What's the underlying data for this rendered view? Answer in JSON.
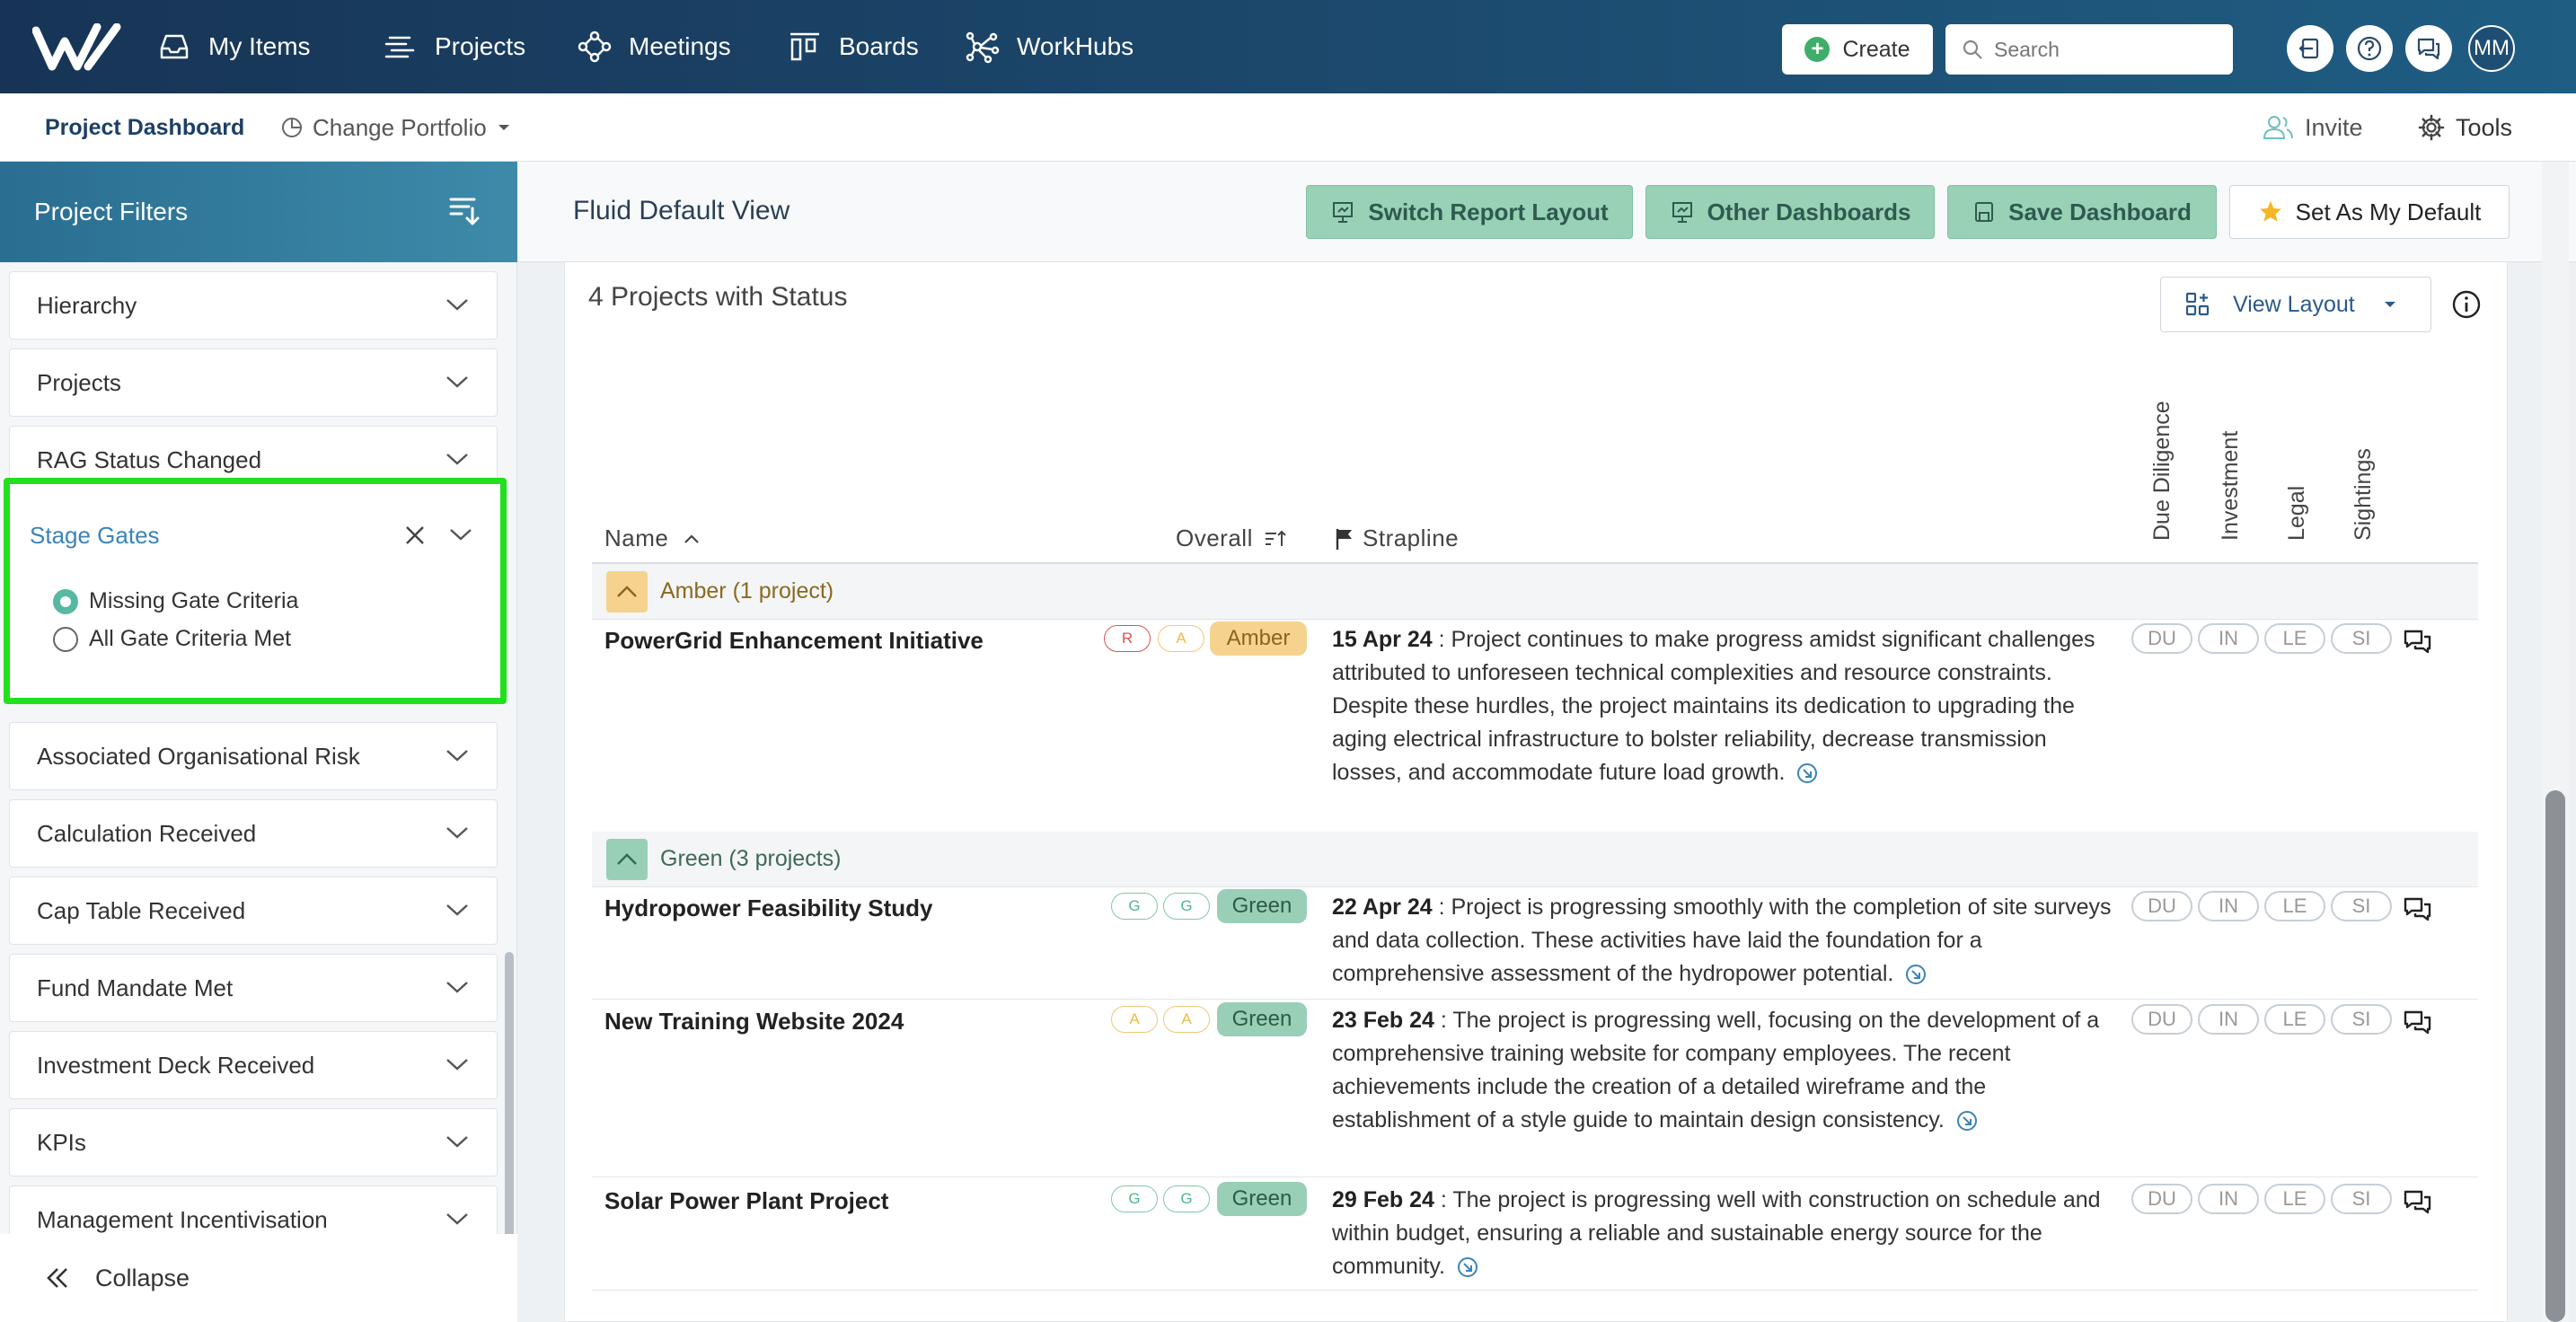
{
  "nav": {
    "items": [
      {
        "label": "My Items",
        "icon": "inbox-icon"
      },
      {
        "label": "Projects",
        "icon": "projects-icon"
      },
      {
        "label": "Meetings",
        "icon": "meetings-icon"
      },
      {
        "label": "Boards",
        "icon": "boards-icon"
      },
      {
        "label": "WorkHubs",
        "icon": "workhubs-icon"
      }
    ],
    "create_label": "Create",
    "search_placeholder": "Search",
    "avatar_initials": "MM"
  },
  "subnav": {
    "dashboard_label": "Project Dashboard",
    "portfolio_label": "Change Portfolio",
    "invite_label": "Invite",
    "tools_label": "Tools"
  },
  "sidebar": {
    "title": "Project Filters",
    "filters": [
      "Hierarchy",
      "Projects",
      "RAG Status Changed"
    ],
    "open_filter": {
      "title": "Stage Gates",
      "options": [
        {
          "label": "Missing Gate Criteria",
          "selected": true
        },
        {
          "label": "All Gate Criteria Met",
          "selected": false
        }
      ]
    },
    "filters_after": [
      "Associated Organisational Risk",
      "Calculation Received",
      "Cap Table Received",
      "Fund Mandate Met",
      "Investment Deck Received",
      "KPIs",
      "Management Incentivisation"
    ],
    "collapse_label": "Collapse"
  },
  "main": {
    "view_title": "Fluid Default View",
    "buttons": {
      "switch_layout": "Switch Report Layout",
      "other_dashboards": "Other Dashboards",
      "save_dashboard": "Save Dashboard",
      "set_default": "Set As My Default"
    },
    "panel_title": "4 Projects with Status",
    "view_layout_label": "View Layout",
    "columns": {
      "name": "Name",
      "overall": "Overall",
      "strapline": "Strapline",
      "rotated": [
        "Due Diligence",
        "Investment",
        "Legal",
        "Sightings"
      ]
    },
    "groups": [
      {
        "label": "Amber (1 project)",
        "color": "#f5d38f",
        "projects": [
          {
            "name": "PowerGrid Enhancement Initiative",
            "rag": [
              "R",
              "A"
            ],
            "status": "Amber",
            "date": "15 Apr 24",
            "text": ": Project continues to make progress amidst significant challenges attributed to unforeseen technical complexities and resource constraints. Despite these hurdles, the project maintains its dedication to upgrading the aging electrical infrastructure to bolster reliability, decrease transmission losses, and accommodate future load growth."
          }
        ]
      },
      {
        "label": "Green (3 projects)",
        "color": "#98cfb6",
        "projects": [
          {
            "name": "Hydropower Feasibility Study",
            "rag": [
              "G",
              "G"
            ],
            "status": "Green",
            "date": "22 Apr 24",
            "text": ": Project is progressing smoothly with the completion of site surveys and data collection. These activities have laid the foundation for a comprehensive assessment of the hydropower potential."
          },
          {
            "name": "New Training Website 2024",
            "rag": [
              "A",
              "A"
            ],
            "status": "Green",
            "date": "23 Feb 24",
            "text": ": The project is progressing well, focusing on the development of a comprehensive training website for company employees. The recent achievements include the creation of a detailed wireframe and the establishment of a style guide to maintain design consistency."
          },
          {
            "name": "Solar Power Plant Project",
            "rag": [
              "G",
              "G"
            ],
            "status": "Green",
            "date": "29 Feb 24",
            "text": ": The project is progressing well with construction on schedule and within budget, ensuring a reliable and sustainable energy source for the community."
          }
        ]
      }
    ],
    "tags": [
      "DU",
      "IN",
      "LE",
      "SI"
    ]
  },
  "colors": {
    "accent_green": "#98d1b6",
    "highlight_green": "#22e01e",
    "red": "#e05050",
    "amber": "#f0b84a",
    "green": "#4db88a"
  }
}
